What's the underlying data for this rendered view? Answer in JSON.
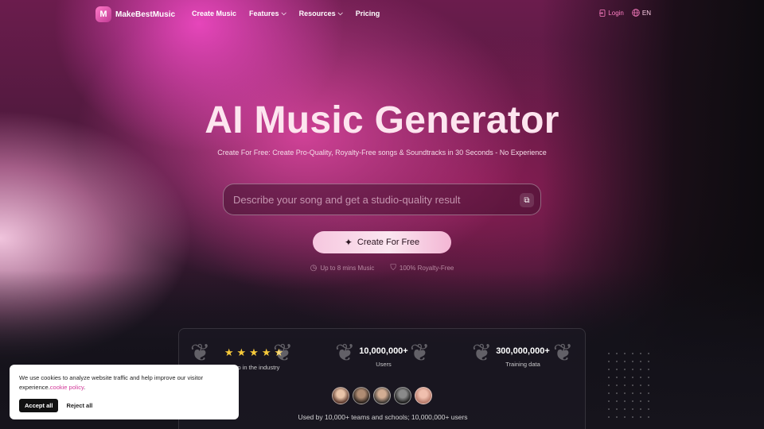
{
  "nav": {
    "logo_mark": "M",
    "brand": "MakeBestMusic",
    "links": [
      {
        "label": "Create Music",
        "dropdown": false
      },
      {
        "label": "Features",
        "dropdown": true
      },
      {
        "label": "Resources",
        "dropdown": true
      },
      {
        "label": "Pricing",
        "dropdown": false
      }
    ],
    "login": "Login",
    "language": "EN"
  },
  "hero": {
    "title": "AI Music Generator",
    "subtitle": "Create For Free: Create Pro-Quality, Royalty-Free songs & Soundtracks in 30 Seconds - No Experience",
    "prompt_placeholder": "Describe your song and get a studio-quality result",
    "prompt_value": "",
    "cta_label": "Create For Free",
    "features": [
      "Up to 8 mins Music",
      "100% Royalty-Free"
    ]
  },
  "stats": {
    "items": [
      {
        "big": "★★★★★",
        "small": "Top in the industry"
      },
      {
        "big": "10,000,000+",
        "small": "Users"
      },
      {
        "big": "300,000,000+",
        "small": "Training data"
      }
    ],
    "used_by": "Used by 10,000+ teams and schools; 10,000,000+ users"
  },
  "cookie": {
    "message": "We use cookies to analyze website traffic and help improve our visitor experience.",
    "link": "cookie policy",
    "suffix": ".",
    "accept": "Accept all",
    "reject": "Reject all"
  },
  "colors": {
    "accent": "#ff7fc4",
    "star": "#f7c93a",
    "link": "#d23a9a"
  }
}
